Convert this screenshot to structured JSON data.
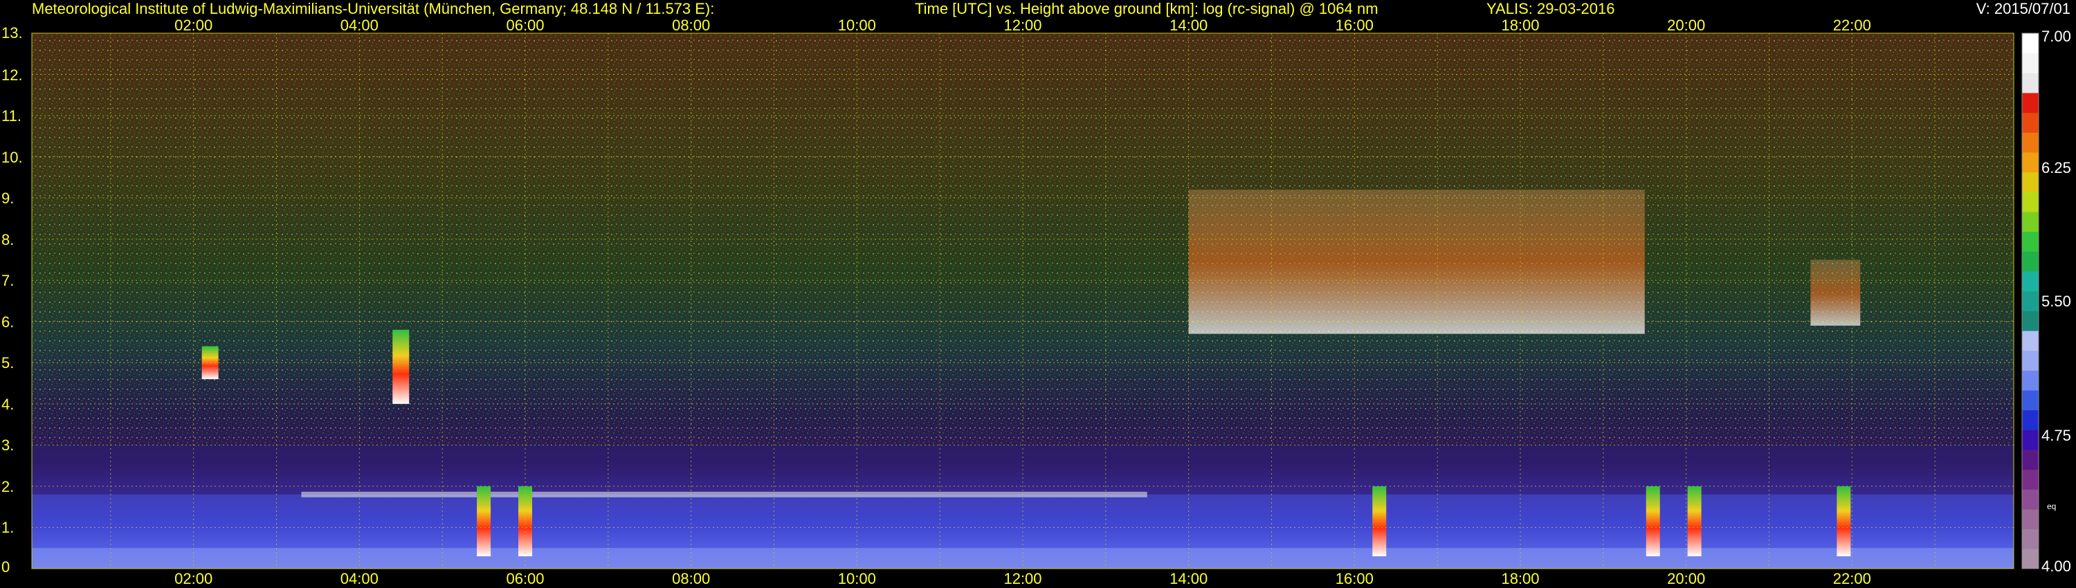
{
  "header": {
    "institute": "Meteorological Institute of Ludwig-Maximilians-Universität (München, Germany; 48.148 N / 11.573 E):",
    "plot_desc": "Time [UTC] vs. Height above ground [km]: log (rc-signal) @ 1064 nm",
    "instrument_date": "YALIS: 29-03-2016",
    "version": "V: 2015/07/01"
  },
  "chart_data": {
    "type": "heatmap",
    "x_ticks": [
      "02:00",
      "04:00",
      "06:00",
      "08:00",
      "10:00",
      "12:00",
      "14:00",
      "16:00",
      "18:00",
      "20:00",
      "22:00"
    ],
    "x_tick_hours": [
      2,
      4,
      6,
      8,
      10,
      12,
      14,
      16,
      18,
      20,
      22
    ],
    "xlim_hours": [
      0.05,
      23.95
    ],
    "y_ticks": [
      "0",
      "1.",
      "2.",
      "3.",
      "4.",
      "5.",
      "6.",
      "7.",
      "8.",
      "9.",
      "10.",
      "11.",
      "12.",
      "13."
    ],
    "y_tick_values": [
      0,
      1,
      2,
      3,
      4,
      5,
      6,
      7,
      8,
      9,
      10,
      11,
      12,
      13
    ],
    "ylim_km": [
      0,
      13
    ],
    "grid": true,
    "colorbar": {
      "labels": [
        "7.00",
        "6.25",
        "5.50",
        "4.75",
        "4.00"
      ],
      "label_values": [
        7.0,
        6.25,
        5.5,
        4.75,
        4.0
      ],
      "range": [
        4.0,
        7.0
      ],
      "eq_mark": "eq",
      "eq_value": 4.35,
      "colors": [
        "#ab8fa6",
        "#a27fa0",
        "#9b6a9a",
        "#8e4e93",
        "#7a2e8a",
        "#5a1a85",
        "#3a10b0",
        "#2030d0",
        "#3a5ae0",
        "#6e86ee",
        "#9aaaf2",
        "#b4c0f4",
        "#1a8a78",
        "#1aa090",
        "#1ab39f",
        "#22b04a",
        "#35c43c",
        "#7ad020",
        "#bada18",
        "#e0c810",
        "#f0a010",
        "#f07810",
        "#e84a10",
        "#e01c10",
        "#e8e8e8",
        "#f5f5f5",
        "#ffffff"
      ]
    },
    "features": {
      "boundary_layer_top_km": 1.8,
      "aerosol_layer_top_km": 3.0,
      "cirrus_layers": [
        {
          "start_hour": 14.0,
          "end_hour": 19.5,
          "base_km": 5.7,
          "top_km": 9.2
        },
        {
          "start_hour": 21.5,
          "end_hour": 22.1,
          "base_km": 5.9,
          "top_km": 7.5
        }
      ],
      "isolated_clouds": [
        {
          "hour": 2.2,
          "base_km": 4.6,
          "top_km": 5.4
        },
        {
          "hour": 4.5,
          "base_km": 4.0,
          "top_km": 5.8
        }
      ],
      "low_convective_clouds_hours": [
        5.5,
        6.0,
        16.3,
        19.6,
        20.1,
        21.9
      ]
    }
  }
}
